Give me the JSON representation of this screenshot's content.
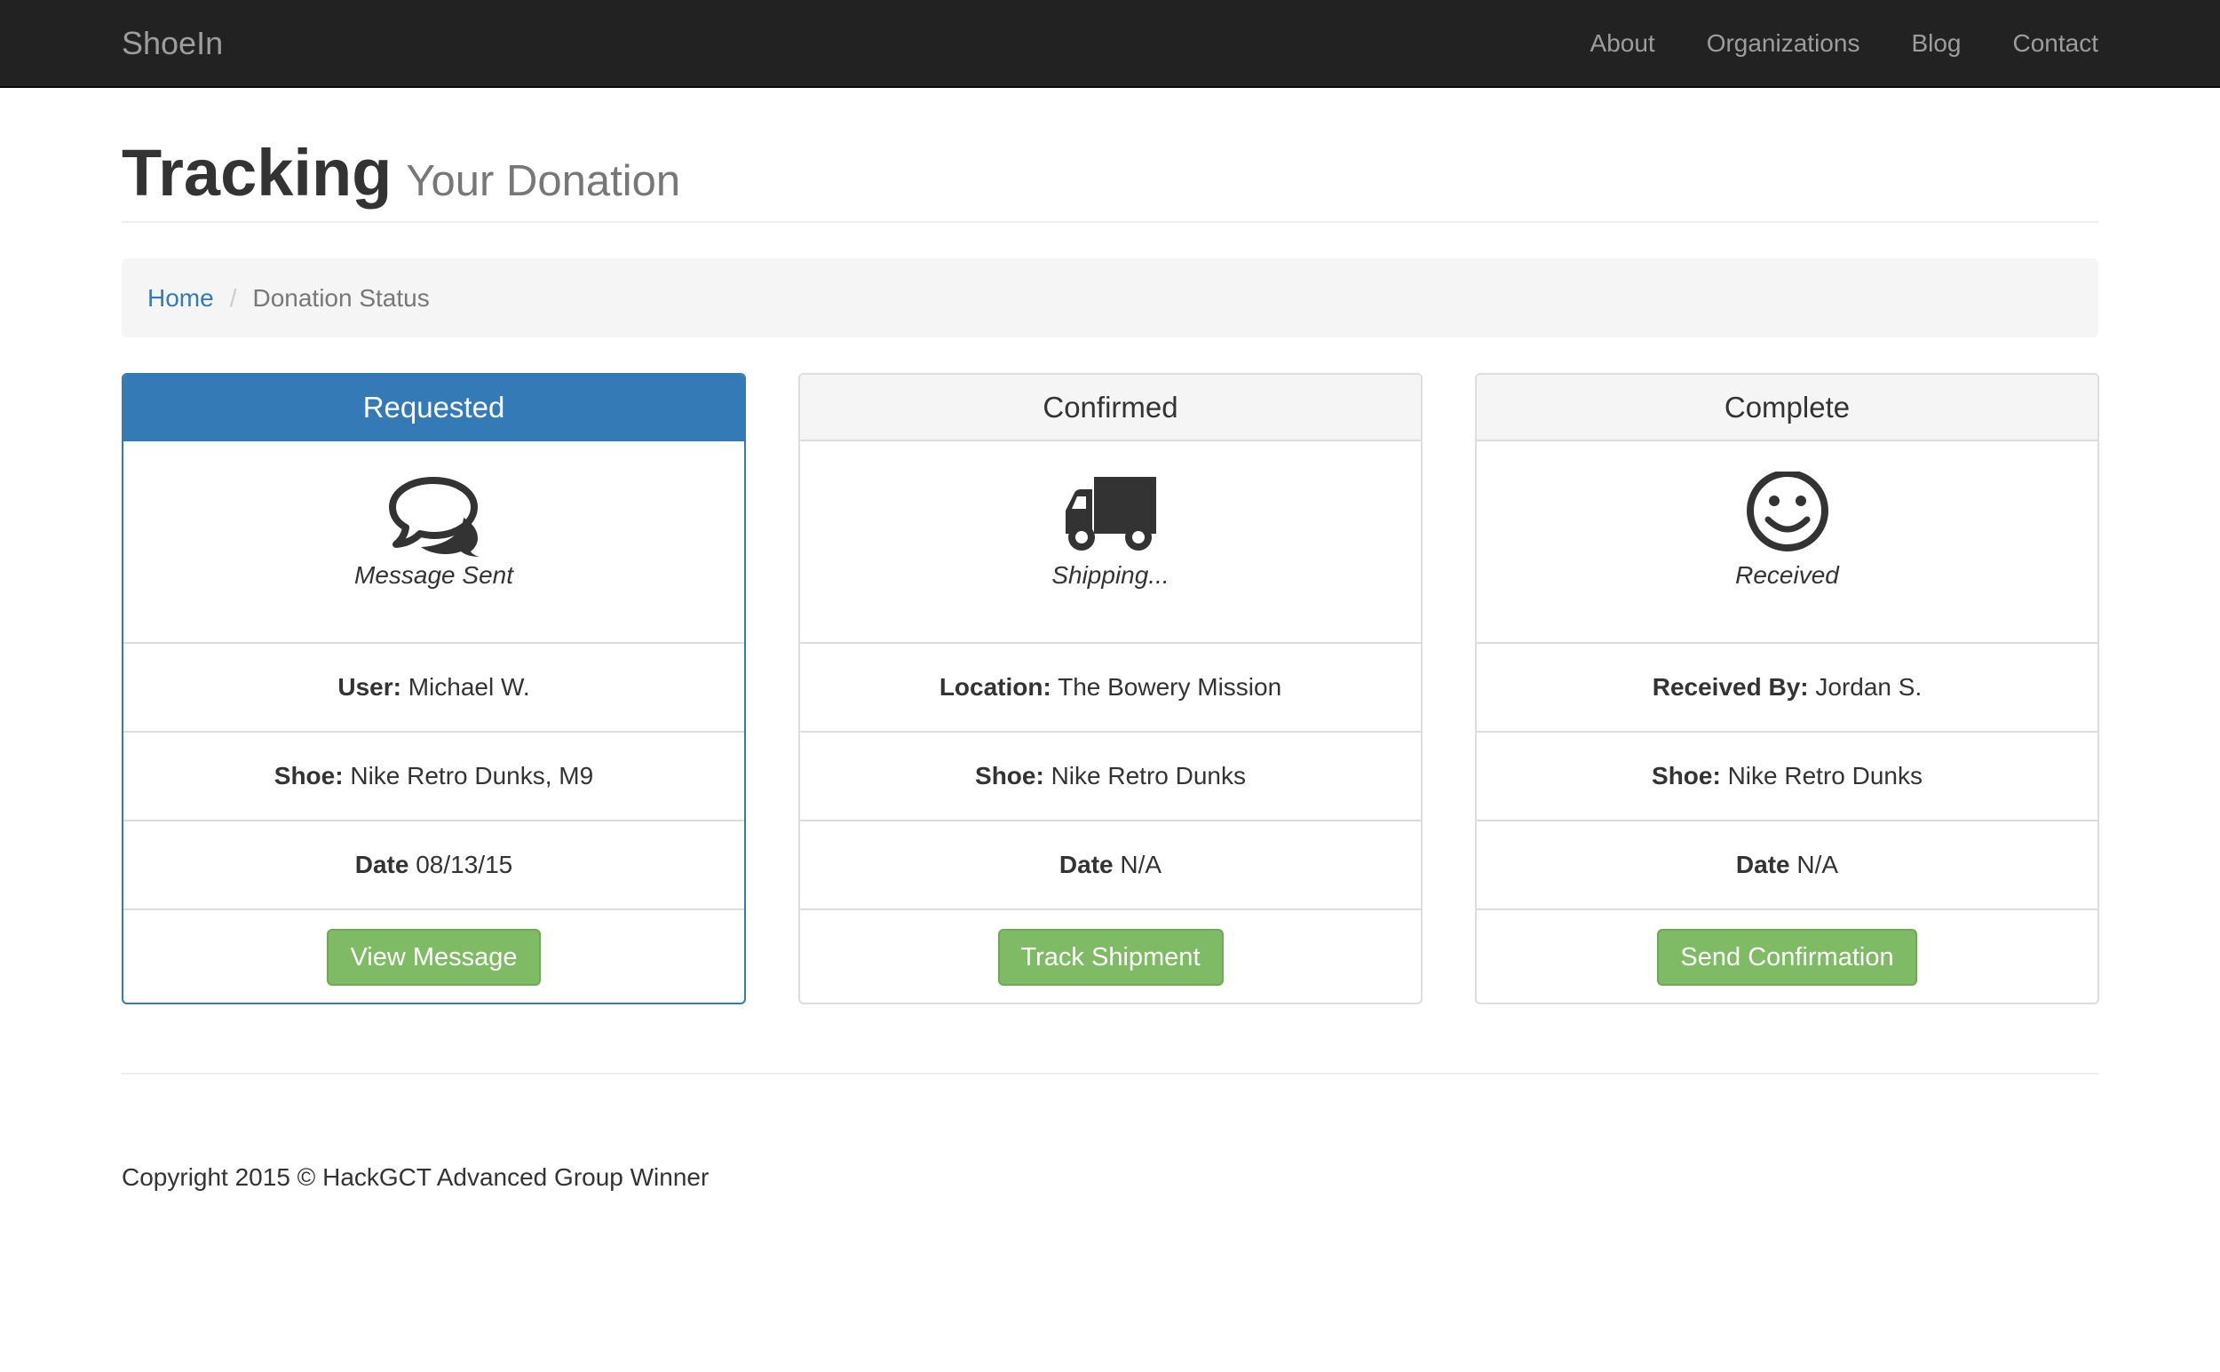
{
  "navbar": {
    "brand": "ShoeIn",
    "links": [
      "About",
      "Organizations",
      "Blog",
      "Contact"
    ]
  },
  "header": {
    "title": "Tracking",
    "subtitle": "Your Donation"
  },
  "breadcrumb": {
    "home": "Home",
    "current": "Donation Status"
  },
  "panels": [
    {
      "heading": "Requested",
      "icon": "comments-icon",
      "caption": "Message Sent",
      "rows": [
        {
          "label": "User:",
          "value": "Michael W."
        },
        {
          "label": "Shoe:",
          "value": "Nike Retro Dunks, M9"
        },
        {
          "label": "Date",
          "value": "08/13/15"
        }
      ],
      "button": "View Message"
    },
    {
      "heading": "Confirmed",
      "icon": "truck-icon",
      "caption": "Shipping...",
      "rows": [
        {
          "label": "Location:",
          "value": "The Bowery Mission"
        },
        {
          "label": "Shoe:",
          "value": "Nike Retro Dunks"
        },
        {
          "label": "Date",
          "value": "N/A"
        }
      ],
      "button": "Track Shipment"
    },
    {
      "heading": "Complete",
      "icon": "smile-icon",
      "caption": "Received",
      "rows": [
        {
          "label": "Received By:",
          "value": "Jordan S."
        },
        {
          "label": "Shoe:",
          "value": "Nike Retro Dunks"
        },
        {
          "label": "Date",
          "value": "N/A"
        }
      ],
      "button": "Send Confirmation"
    }
  ],
  "footer": {
    "copyright": "Copyright 2015 © HackGCT Advanced Group Winner"
  },
  "colors": {
    "navbar": "#222222",
    "primary": "#337ab7",
    "success": "#7fba65",
    "link": "#337ab7"
  }
}
